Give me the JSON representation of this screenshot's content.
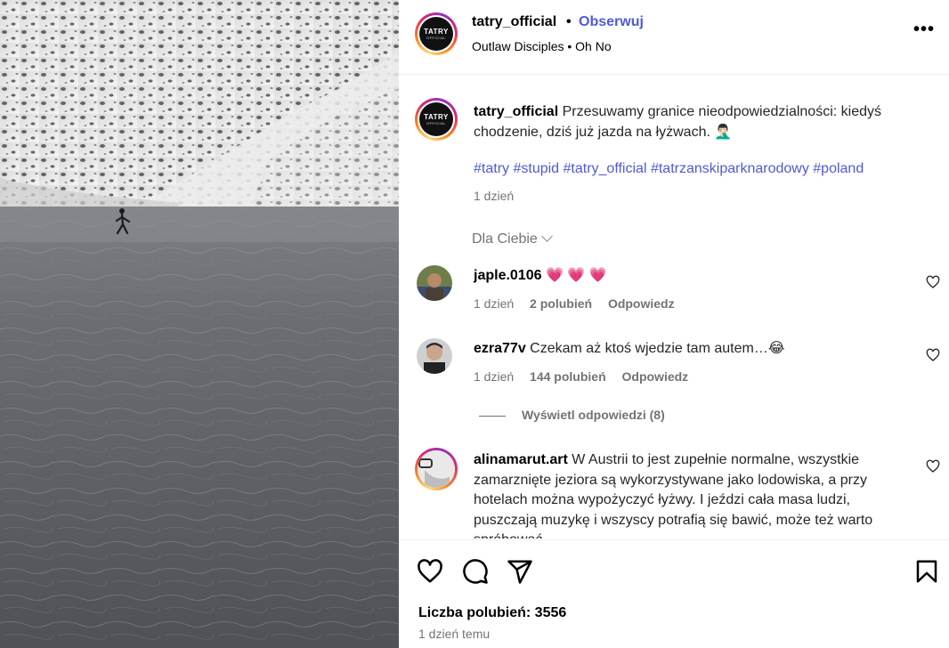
{
  "header": {
    "username": "tatry_official",
    "separator": "•",
    "follow_label": "Obserwuj",
    "audio": "Outlaw Disciples • Oh No",
    "more_label": "•••",
    "avatar_logo_text": "TATRY",
    "avatar_logo_sub": "OFFICIAL"
  },
  "caption": {
    "username": "tatry_official",
    "text": "Przesuwamy granice nieodpowiedzialności: kiedyś chodzenie, dziś już jazda na łyżwach. 🤦🏻‍♂️",
    "hashtags": [
      "#tatry",
      "#stupid",
      "#tatry_official",
      "#tatrzanskiparknarodowy",
      "#poland"
    ],
    "time": "1 dzień"
  },
  "for_you_label": "Dla Ciebie",
  "comments": [
    {
      "username": "japle.0106",
      "text": "💗 💗 💗",
      "time": "1 dzień",
      "likes": "2 polubień",
      "reply": "Odpowiedz",
      "avatar_icon": "user-avatar-icon"
    },
    {
      "username": "ezra77v",
      "text": "Czekam aż ktoś wjedzie tam autem…😂",
      "time": "1 dzień",
      "likes": "144 polubień",
      "reply": "Odpowiedz",
      "avatar_icon": "user-avatar-icon"
    },
    {
      "username": "alinamarut.art",
      "text": "W Austrii to jest zupełnie normalne, wszystkie zamarznięte jeziora są wykorzystywane jako lodowiska, a przy hotelach można wypożyczyć łyżwy. I jeździ cała masa ludzi, puszczają muzykę i wszyscy potrafią się bawić, może też warto spróbować",
      "avatar_icon": "user-avatar-icon"
    }
  ],
  "view_replies_label": "Wyświetl odpowiedzi (8)",
  "actions": {
    "icons": [
      "heart-icon",
      "comment-icon",
      "share-icon",
      "bookmark-icon"
    ]
  },
  "likes_label": "Liczba polubień: 3556",
  "posted_time": "1 dzień temu",
  "colors": {
    "link": "#4f5bd5",
    "muted": "#737373",
    "heart": "#ff3b6b"
  }
}
